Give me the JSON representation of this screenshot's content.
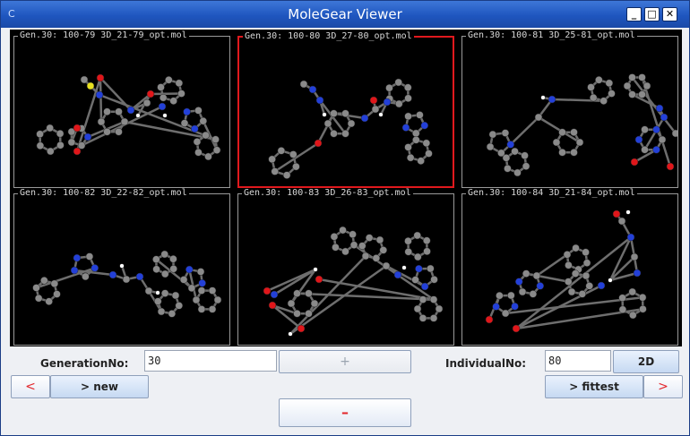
{
  "window": {
    "title": "MoleGear Viewer",
    "app_icon": "C",
    "controls": {
      "minimize": "_",
      "maximize": "□",
      "close": "✕"
    }
  },
  "panels": [
    {
      "title": "Gen.30: 100-79 3D_21-79_opt.mol",
      "selected": false
    },
    {
      "title": "Gen.30: 100-80 3D_27-80_opt.mol",
      "selected": true
    },
    {
      "title": "Gen.30: 100-81 3D_25-81_opt.mol",
      "selected": false
    },
    {
      "title": "Gen.30: 100-82 3D_22-82_opt.mol",
      "selected": false
    },
    {
      "title": "Gen.30: 100-83 3D_26-83_opt.mol",
      "selected": false
    },
    {
      "title": "Gen.30: 100-84 3D_21-84_opt.mol",
      "selected": false
    }
  ],
  "controls": {
    "generation_label": "GenerationNo:",
    "generation_value": "30",
    "plus_label": "+",
    "individual_label": "IndividualNo:",
    "individual_value": "80",
    "mode_2d_label": "2D",
    "prev_label": "<",
    "new_label": "> new",
    "fittest_label": "> fittest",
    "next_label": ">",
    "minus_label": "–"
  },
  "colors": {
    "carbon": "#8a8a8a",
    "nitrogen": "#2340d8",
    "oxygen": "#e0161a",
    "sulfur": "#e8e020",
    "hydrogen": "#ffffff",
    "selection": "#e1191d"
  }
}
